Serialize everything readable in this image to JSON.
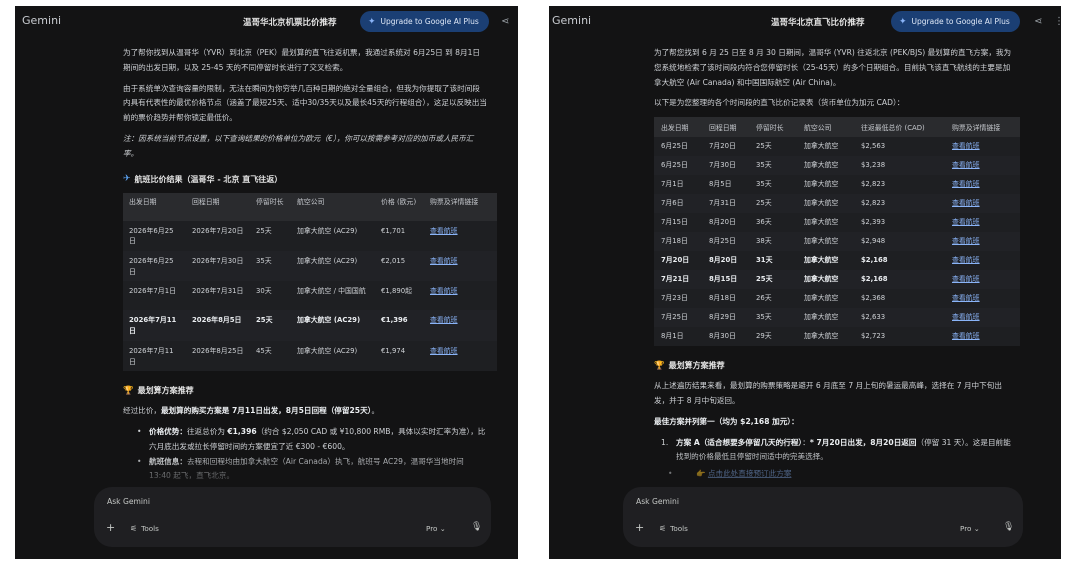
{
  "left": {
    "brand": "Gemini",
    "title": "温哥华北京机票比价推荐",
    "upgrade_label": "Upgrade to Google AI Plus",
    "share_icon": "share-icon",
    "intro_1": "为了帮你找到从温哥华（YVR）到北京（PEK）最划算的直飞往返机票，我通过系统对 6月25日 到 8月1日 期间的出发日期，以及 25-45 天的不同停留时长进行了交叉检索。",
    "intro_2": "由于系统单次查询容量的限制，无法在瞬间为你穷举几百种日期的绝对全量组合，但我为你提取了该时间段内具有代表性的最优价格节点（涵盖了最短25天、适中30/35天以及最长45天的行程组合），这足以反映出当前的票价趋势并帮你锁定最低价。",
    "note": "注：因系统当前节点设置，以下查询结果的价格单位为欧元（€），你可以按需参考对应的加币或人民币汇率。",
    "section_table": "航班比价结果（温哥华 - 北京 直飞往返）",
    "table_headers": [
      "出发日期",
      "回程日期",
      "停留时长",
      "航空公司",
      "价格 (欧元)",
      "购票及详情链接"
    ],
    "table_rows": [
      {
        "dep": "2026年6月25日",
        "ret": "2026年7月20日",
        "stay": "25天",
        "airline": "加拿大航空 (AC29)",
        "price": "€1,701",
        "link": "查看航班",
        "bold": false
      },
      {
        "dep": "2026年6月25日",
        "ret": "2026年7月30日",
        "stay": "35天",
        "airline": "加拿大航空 (AC29)",
        "price": "€2,015",
        "link": "查看航班",
        "bold": false
      },
      {
        "dep": "2026年7月1日",
        "ret": "2026年7月31日",
        "stay": "30天",
        "airline": "加拿大航空 / 中国国航",
        "price": "€1,890起",
        "link": "查看航班",
        "bold": false
      },
      {
        "dep": "2026年7月11日",
        "ret": "2026年8月5日",
        "stay": "25天",
        "airline": "加拿大航空 (AC29)",
        "price": "€1,396",
        "link": "查看航班",
        "bold": true
      },
      {
        "dep": "2026年7月11日",
        "ret": "2026年8月25日",
        "stay": "45天",
        "airline": "加拿大航空 (AC29)",
        "price": "€1,974",
        "link": "查看航班",
        "bold": false
      }
    ],
    "section_reco": "最划算方案推荐",
    "reco_lead_plain": "经过比价，",
    "reco_lead_bold": "最划算的购买方案是 7月11日出发，8月5日回程（停留25天）",
    "reco_lead_end": "。",
    "bullet_1_label": "价格优势：",
    "bullet_1_text_a": "往返总价为 ",
    "bullet_1_price": "€1,396",
    "bullet_1_text_b": "（约合 $2,050 CAD 或 ¥10,800 RMB，具体以实时汇率为准），比六月底出发或拉长停留时间的方案便宜了近 €300 - €600。",
    "bullet_2_label": "航班信息：",
    "bullet_2_text": "去程和回程均由加拿大航空（Air Canada）执飞，航班号 AC29，温哥华当地时间 13:40 起飞，直飞北京。",
    "composer_placeholder": "Ask Gemini",
    "tools_label": "Tools",
    "model_label": "Pro"
  },
  "right": {
    "brand": "Gemini",
    "title": "温哥华北京直飞比价推荐",
    "upgrade_label": "Upgrade to Google AI Plus",
    "intro_1": "为了帮您找到 6 月 25 日至 8 月 30 日期间，温哥华 (YVR) 往返北京 (PEK/BJS) 最划算的直飞方案，我为您系统地检索了该时间段内符合您停留时长（25-45天）的多个日期组合。目前执飞该直飞航线的主要是加拿大航空 (Air Canada) 和中国国际航空 (Air China)。",
    "intro_2": "以下是为您整理的各个时间段的直飞比价记录表（货币单位为加元 CAD）：",
    "table_headers": [
      "出发日期",
      "回程日期",
      "停留时长",
      "航空公司",
      "往返最低总价 (CAD)",
      "购票及详情链接"
    ],
    "table_rows": [
      {
        "dep": "6月25日",
        "ret": "7月20日",
        "stay": "25天",
        "airline": "加拿大航空",
        "price": "$2,563",
        "link": "查看航班",
        "bold": false
      },
      {
        "dep": "6月25日",
        "ret": "7月30日",
        "stay": "35天",
        "airline": "加拿大航空",
        "price": "$3,238",
        "link": "查看航班",
        "bold": false
      },
      {
        "dep": "7月1日",
        "ret": "8月5日",
        "stay": "35天",
        "airline": "加拿大航空",
        "price": "$2,823",
        "link": "查看航班",
        "bold": false
      },
      {
        "dep": "7月6日",
        "ret": "7月31日",
        "stay": "25天",
        "airline": "加拿大航空",
        "price": "$2,823",
        "link": "查看航班",
        "bold": false
      },
      {
        "dep": "7月15日",
        "ret": "8月20日",
        "stay": "36天",
        "airline": "加拿大航空",
        "price": "$2,393",
        "link": "查看航班",
        "bold": false
      },
      {
        "dep": "7月18日",
        "ret": "8月25日",
        "stay": "38天",
        "airline": "加拿大航空",
        "price": "$2,948",
        "link": "查看航班",
        "bold": false
      },
      {
        "dep": "7月20日",
        "ret": "8月20日",
        "stay": "31天",
        "airline": "加拿大航空",
        "price": "$2,168",
        "link": "查看航班",
        "bold": true
      },
      {
        "dep": "7月21日",
        "ret": "8月15日",
        "stay": "25天",
        "airline": "加拿大航空",
        "price": "$2,168",
        "link": "查看航班",
        "bold": true
      },
      {
        "dep": "7月23日",
        "ret": "8月18日",
        "stay": "26天",
        "airline": "加拿大航空",
        "price": "$2,368",
        "link": "查看航班",
        "bold": false
      },
      {
        "dep": "7月25日",
        "ret": "8月29日",
        "stay": "35天",
        "airline": "加拿大航空",
        "price": "$2,633",
        "link": "查看航班",
        "bold": false
      },
      {
        "dep": "8月1日",
        "ret": "8月30日",
        "stay": "29天",
        "airline": "加拿大航空",
        "price": "$2,723",
        "link": "查看航班",
        "bold": false
      }
    ],
    "section_reco": "最划算方案推荐",
    "reco_text": "从上述遍历结果来看，最划算的购票策略是避开 6 月底至 7 月上旬的暑运最高峰，选择在 7 月中下旬出发，并于 8 月中旬返回。",
    "best_label": "最佳方案并列第一（均为 $2,168 加元）：",
    "item_num": "1.",
    "item_bold": "方案 A（适合想要多停留几天的行程）",
    "item_mid": "：",
    "item_bold_2": "* 7月20日出发，8月20日返回",
    "item_end": "（停留 31 天）。这是目前能找到的价格最低且停留时间适中的完美选择。",
    "sub_link": "点击此处直接预订此方案",
    "composer_placeholder": "Ask Gemini",
    "tools_label": "Tools",
    "model_label": "Pro"
  }
}
